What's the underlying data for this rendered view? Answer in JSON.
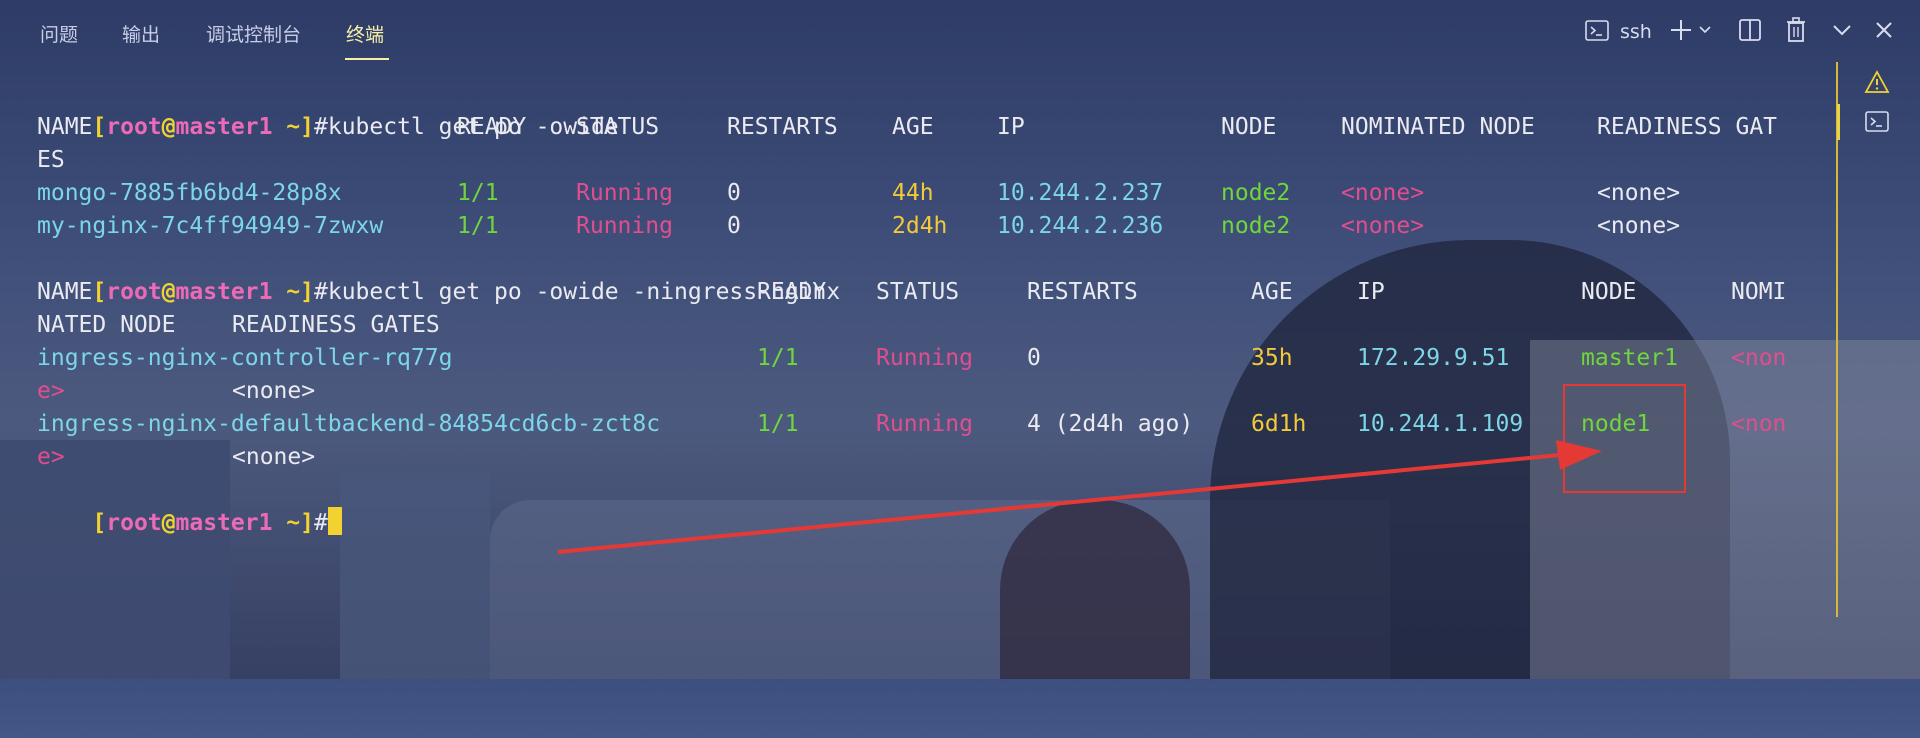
{
  "panel": {
    "tabs": [
      {
        "label": "问题"
      },
      {
        "label": "输出"
      },
      {
        "label": "调试控制台"
      },
      {
        "label": "终端"
      }
    ],
    "active_tab": "终端",
    "terminal_profile": "ssh"
  },
  "terminal": {
    "prompt": {
      "open": "[",
      "user": "root",
      "at": "@",
      "host": "master1",
      "path": " ~",
      "close": "]",
      "hash": "#"
    },
    "lines": [
      {
        "type": "prompt",
        "command": "kubectl get po -owide"
      },
      {
        "type": "text",
        "cells": [
          "NAME",
          "READY",
          "STATUS",
          "RESTARTS",
          "AGE",
          "IP",
          "NODE",
          "NOMINATED NODE",
          "READINESS GAT"
        ]
      },
      {
        "type": "text",
        "cells": [
          "ES"
        ]
      },
      {
        "type": "text",
        "cells": [
          "mongo-7885fb6bd4-28p8x",
          "1/1",
          "Running",
          "0",
          "44h",
          "10.244.2.237",
          "node2",
          "<none>",
          "<none>"
        ]
      },
      {
        "type": "text",
        "cells": [
          "my-nginx-7c4ff94949-7zwxw",
          "1/1",
          "Running",
          "0",
          "2d4h",
          "10.244.2.236",
          "node2",
          "<none>",
          "<none>"
        ]
      },
      {
        "type": "prompt",
        "command": "kubectl get po -owide -ningress-nginx"
      },
      {
        "type": "text",
        "cells": [
          "NAME",
          "READY",
          "STATUS",
          "RESTARTS",
          "AGE",
          "IP",
          "NODE",
          "NOMI"
        ]
      },
      {
        "type": "text",
        "cells": [
          "NATED NODE",
          "READINESS GATES"
        ]
      },
      {
        "type": "text",
        "cells": [
          "ingress-nginx-controller-rq77g",
          "1/1",
          "Running",
          "0",
          "35h",
          "172.29.9.51",
          "master1",
          "<non"
        ]
      },
      {
        "type": "text",
        "cells": [
          "e>",
          "<none>"
        ]
      },
      {
        "type": "text",
        "cells": [
          "ingress-nginx-defaultbackend-84854cd6cb-zct8c",
          "1/1",
          "Running",
          "4 (2d4h ago)",
          "6d1h",
          "10.244.1.109",
          "node1",
          "<non"
        ]
      },
      {
        "type": "text",
        "cells": [
          "e>",
          "<none>"
        ]
      },
      {
        "type": "prompt",
        "command": ""
      }
    ]
  },
  "colors": {
    "prompt_bracket": "#f1d230",
    "prompt_user": "#ec6ab6",
    "pod_name": "#7dd6e8",
    "ready": "#6fd63b",
    "status": "#e04e8e",
    "age": "#f1c93a",
    "ip": "#7dd6e8",
    "node": "#6fd63b",
    "nominated": "#e04e8e",
    "annotation": "#e53935",
    "active_tab": "#f5f0a8"
  },
  "icons": {
    "terminal_profile": "terminal-icon",
    "add": "plus-icon",
    "add_menu": "chevron-down-icon",
    "split": "split-terminal-icon",
    "delete": "trash-icon",
    "maximize": "chevron-up-icon",
    "close": "close-icon",
    "warning": "warning-icon",
    "side_terminal": "terminal-icon"
  }
}
